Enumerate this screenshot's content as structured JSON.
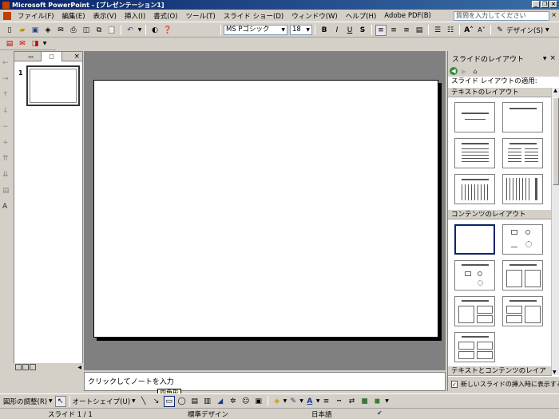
{
  "window": {
    "title": "Microsoft PowerPoint - [プレゼンテーション1]"
  },
  "menu": {
    "items": [
      "ファイル(F)",
      "編集(E)",
      "表示(V)",
      "挿入(I)",
      "書式(O)",
      "ツール(T)",
      "スライド ショー(D)",
      "ウィンドウ(W)",
      "ヘルプ(H)",
      "Adobe PDF(B)"
    ],
    "help_placeholder": "質問を入力してください"
  },
  "toolbar": {
    "font_name": "MS Pゴシック",
    "font_size": "18",
    "bold": "B",
    "italic": "I",
    "underline": "U",
    "shadow": "S",
    "design_label": "デザイン(S)"
  },
  "outline": {
    "slide_number": "1"
  },
  "notes": {
    "placeholder": "クリックしてノートを入力"
  },
  "taskpane": {
    "title": "スライドのレイアウト",
    "apply_label": "スライド レイアウトの適用:",
    "sections": {
      "text": "テキストのレイアウト",
      "content": "コンテンツのレイアウト",
      "text_content": "テキストとコンテンツのレイアウト"
    },
    "checkbox_label": "新しいスライドの挿入時に表示する"
  },
  "drawbar": {
    "draw_menu": "図形の調整(R)",
    "autoshape_menu": "オートシェイプ(U)",
    "tooltip": "四角形"
  },
  "status": {
    "slide": "スライド 1 / 1",
    "design": "標準デザイン",
    "language": "日本語"
  }
}
